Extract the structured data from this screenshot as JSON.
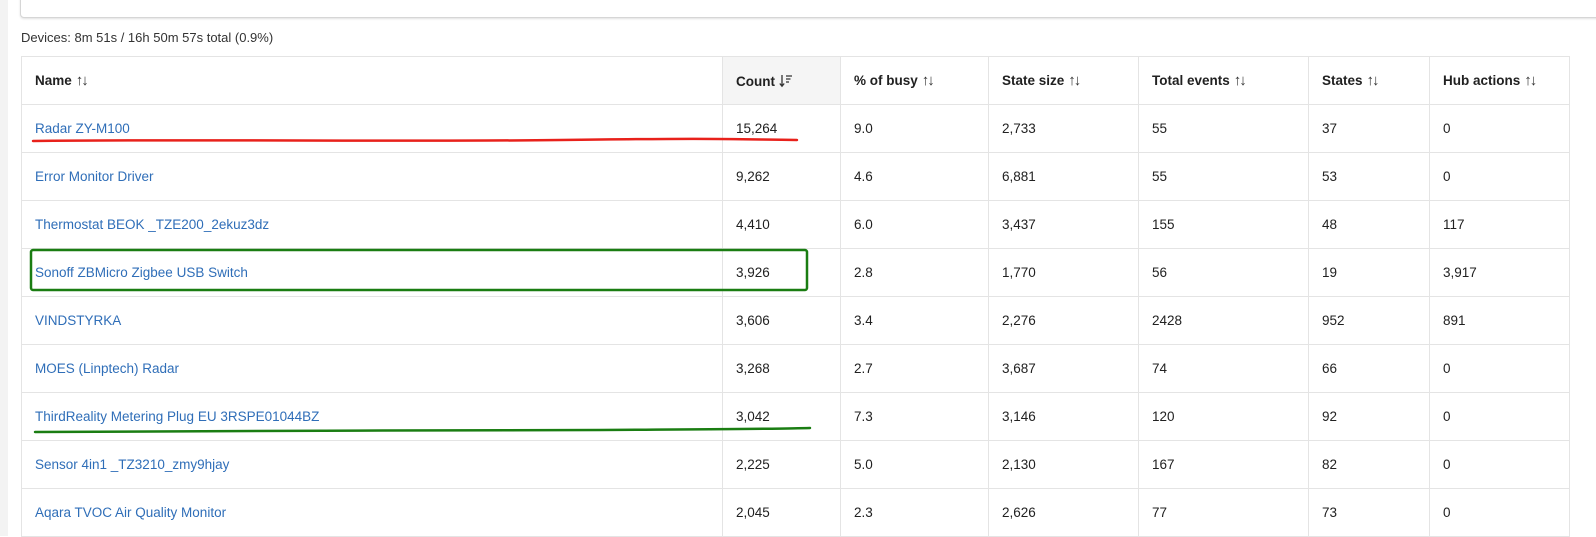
{
  "summary": "Devices: 8m 51s / 16h 50m 57s total (0.9%)",
  "columns": [
    {
      "label": "Name",
      "icon": "sort-both-icon"
    },
    {
      "label": "Count",
      "icon": "sort-descending-icon"
    },
    {
      "label": "% of busy",
      "icon": "sort-both-icon"
    },
    {
      "label": "State size",
      "icon": "sort-both-icon"
    },
    {
      "label": "Total events",
      "icon": "sort-both-icon"
    },
    {
      "label": "States",
      "icon": "sort-both-icon"
    },
    {
      "label": "Hub actions",
      "icon": "sort-both-icon"
    }
  ],
  "rows": [
    {
      "name": "Radar ZY-M100",
      "count": "15,264",
      "busy": "9.0",
      "state_size": "2,733",
      "total_events": "55",
      "states": "37",
      "hub_actions": "0"
    },
    {
      "name": "Error Monitor Driver",
      "count": "9,262",
      "busy": "4.6",
      "state_size": "6,881",
      "total_events": "55",
      "states": "53",
      "hub_actions": "0"
    },
    {
      "name": "Thermostat BEOK _TZE200_2ekuz3dz",
      "count": "4,410",
      "busy": "6.0",
      "state_size": "3,437",
      "total_events": "155",
      "states": "48",
      "hub_actions": "117"
    },
    {
      "name": "Sonoff ZBMicro Zigbee USB Switch",
      "count": "3,926",
      "busy": "2.8",
      "state_size": "1,770",
      "total_events": "56",
      "states": "19",
      "hub_actions": "3,917"
    },
    {
      "name": "VINDSTYRKA",
      "count": "3,606",
      "busy": "3.4",
      "state_size": "2,276",
      "total_events": "2428",
      "states": "952",
      "hub_actions": "891"
    },
    {
      "name": "MOES (Linptech) Radar",
      "count": "3,268",
      "busy": "2.7",
      "state_size": "3,687",
      "total_events": "74",
      "states": "66",
      "hub_actions": "0"
    },
    {
      "name": "ThirdReality Metering Plug EU 3RSPE01044BZ",
      "count": "3,042",
      "busy": "7.3",
      "state_size": "3,146",
      "total_events": "120",
      "states": "92",
      "hub_actions": "0"
    },
    {
      "name": "Sensor 4in1 _TZ3210_zmy9hjay",
      "count": "2,225",
      "busy": "5.0",
      "state_size": "2,130",
      "total_events": "167",
      "states": "82",
      "hub_actions": "0"
    },
    {
      "name": "Aqara TVOC Air Quality Monitor",
      "count": "2,045",
      "busy": "2.3",
      "state_size": "2,626",
      "total_events": "77",
      "states": "73",
      "hub_actions": "0"
    }
  ],
  "annotation_colors": {
    "red": "#e8211b",
    "green": "#1a7d12"
  }
}
